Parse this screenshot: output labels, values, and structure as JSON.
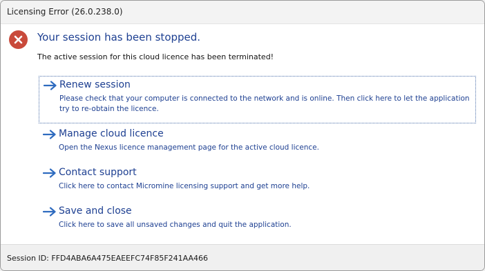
{
  "window": {
    "title": "Licensing Error (26.0.238.0)"
  },
  "message": {
    "icon": "error-icon",
    "heading": "Your session has been stopped.",
    "detail": "The active session for this cloud licence has been terminated!"
  },
  "options": [
    {
      "title": "Renew session",
      "description": "Please check that your computer is connected to the network and is online. Then click here to let the application try to re-obtain the licence."
    },
    {
      "title": "Manage cloud licence",
      "description": "Open the Nexus licence management page for the active cloud licence."
    },
    {
      "title": "Contact support",
      "description": "Click here to contact Micromine licensing support and get more help."
    },
    {
      "title": "Save and close",
      "description": "Click here to save all unsaved changes and quit the application."
    }
  ],
  "footer": {
    "session_id": "Session ID: FFD4ABA6A475EAEEFC74F85F241AA466"
  },
  "colors": {
    "accent": "#1d3f91",
    "arrow": "#2e6bbf",
    "error": "#c94a3b"
  }
}
